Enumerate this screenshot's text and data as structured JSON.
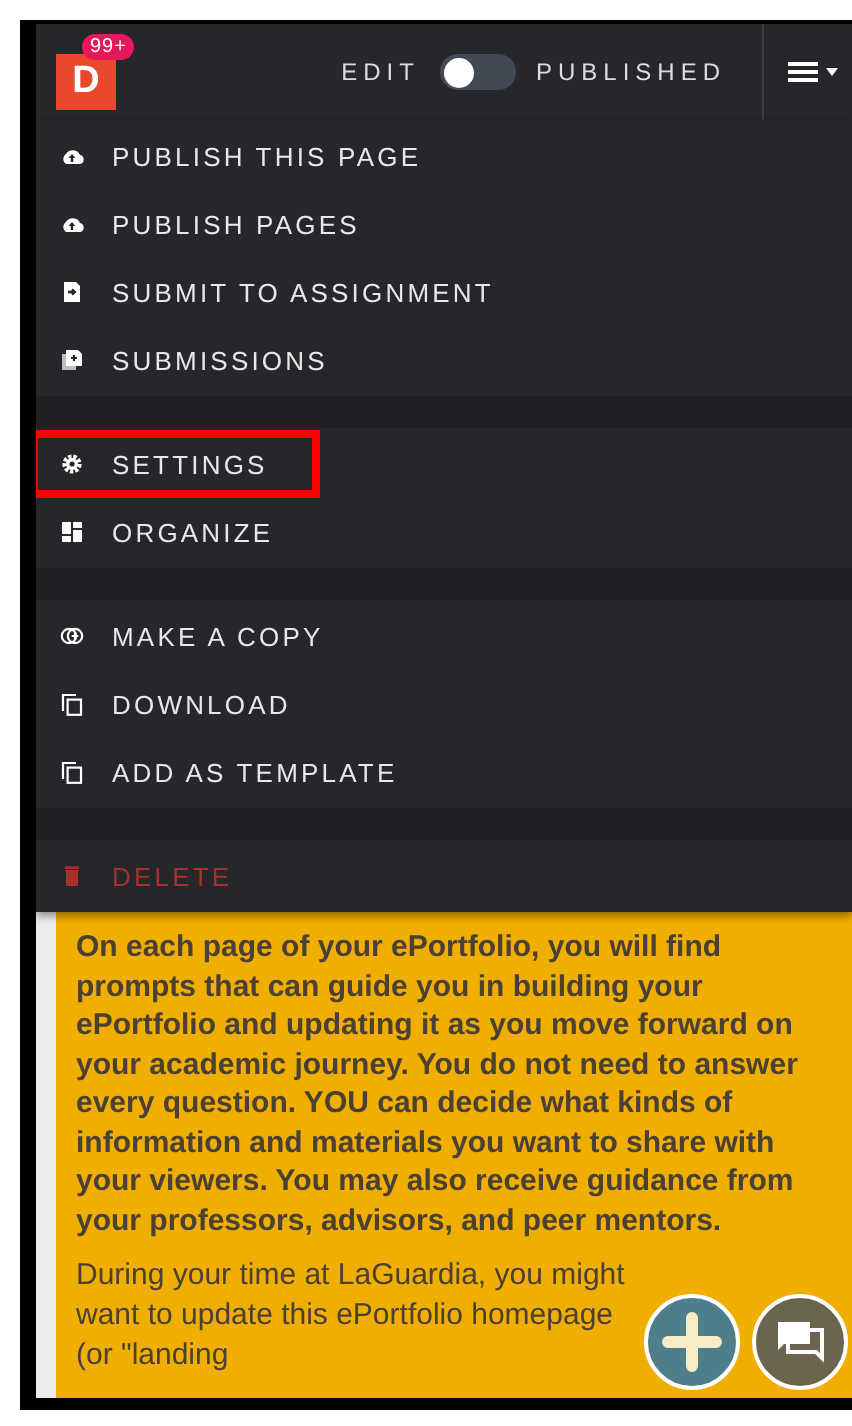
{
  "header": {
    "logo_letter": "D",
    "notification_badge": "99+",
    "edit_label": "EDIT",
    "published_label": "PUBLISHED",
    "toggle": {
      "on": false
    }
  },
  "menu": {
    "groups": [
      {
        "items": [
          {
            "label": "PUBLISH THIS PAGE",
            "kind": "normal",
            "highlighted": false
          },
          {
            "label": "PUBLISH PAGES",
            "kind": "normal",
            "highlighted": false
          },
          {
            "label": "SUBMIT TO ASSIGNMENT",
            "kind": "normal",
            "highlighted": false
          },
          {
            "label": "SUBMISSIONS",
            "kind": "normal",
            "highlighted": false
          }
        ]
      },
      {
        "items": [
          {
            "label": "SETTINGS",
            "kind": "normal",
            "highlighted": true
          },
          {
            "label": "ORGANIZE",
            "kind": "normal",
            "highlighted": false
          }
        ]
      },
      {
        "items": [
          {
            "label": "MAKE A COPY",
            "kind": "normal",
            "highlighted": false
          },
          {
            "label": "DOWNLOAD",
            "kind": "normal",
            "highlighted": false
          },
          {
            "label": "ADD AS TEMPLATE",
            "kind": "normal",
            "highlighted": false
          }
        ]
      },
      {
        "items": [
          {
            "label": "DELETE",
            "kind": "danger",
            "highlighted": false
          }
        ]
      }
    ]
  },
  "content": {
    "paragraphs": [
      "On each page of your ePortfolio, you will find prompts that can guide you in building your ePortfolio and updating it as you move forward on your academic journey. You do not need to answer every question. YOU can decide what kinds of information and materials you want to share with your viewers. You may also receive guidance from your professors, advisors, and peer mentors.",
      "During your time at LaGuardia, you might want to update this ePortfolio homepage (or \"landing"
    ]
  }
}
